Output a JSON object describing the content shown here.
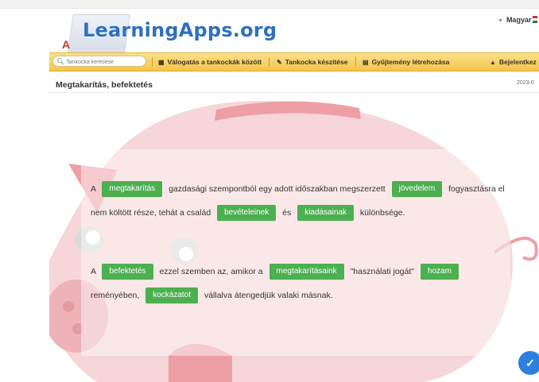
{
  "header": {
    "logo_text": "LearningApps.org",
    "language": "Magyar",
    "language_flag_colors": [
      "#cd2a3e",
      "#ffffff",
      "#436f4d"
    ]
  },
  "nav": {
    "search_placeholder": "Tankocka keresése",
    "items": [
      {
        "label": "Válogatás a tankockák között",
        "icon": "grid-icon"
      },
      {
        "label": "Tankocka készítése",
        "icon": "pencil-icon"
      },
      {
        "label": "Gyűjtemény létrehozása",
        "icon": "collection-icon"
      },
      {
        "label": "Bejelentkez",
        "icon": "user-icon"
      }
    ],
    "bar_color": "#f4c54b"
  },
  "page": {
    "title": "Megtakarítás, befektetés",
    "date": "2023-0"
  },
  "exercise": {
    "chip_color": "#4caf50",
    "paragraph1": {
      "t1": "A",
      "c1": "megtakarítás",
      "t2": "gazdasági szempontból egy adott időszakban megszerzett",
      "c2": "jövedelem",
      "t3": "fogyasztásra el nem költött része, tehát a család",
      "c3": "bevételeinek",
      "t4": "és",
      "c4": "kiadásainak",
      "t5": "különbsége."
    },
    "paragraph2": {
      "t1": "A",
      "c1": "befektetés",
      "t2": "ezzel szemben az, amikor a",
      "c2": "megtakarításaink",
      "t3": "\"használati jogát\"",
      "c3": "hozam",
      "t4": "reményében,",
      "c4": "kockázatot",
      "t5": "vállalva átengedjük valaki másnak."
    }
  },
  "fab": {
    "icon": "check-icon",
    "color": "#2f7fe0"
  }
}
